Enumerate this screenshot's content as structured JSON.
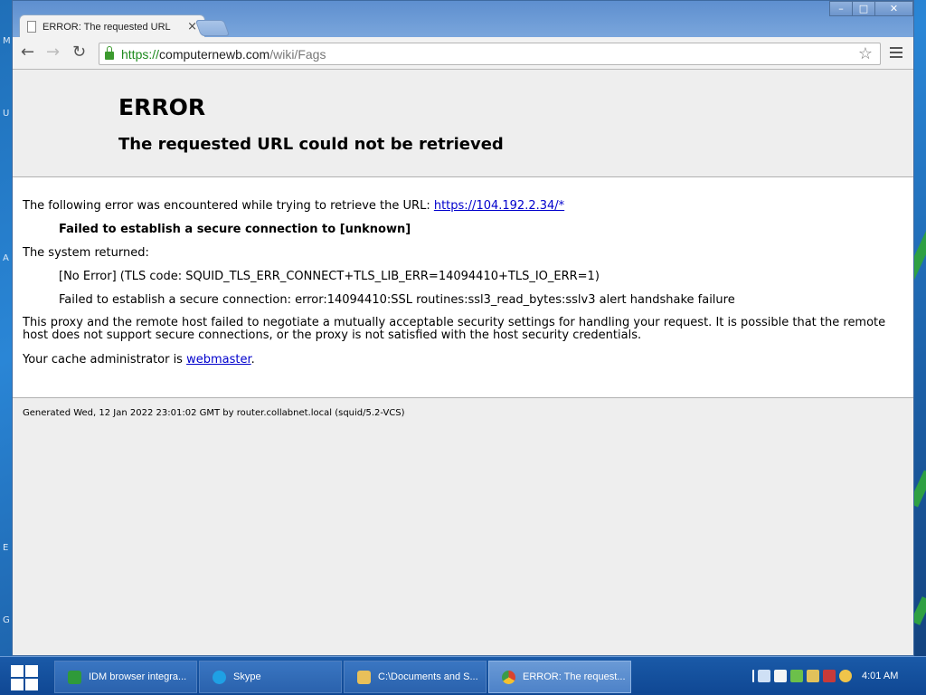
{
  "window": {
    "tab_title": "ERROR: The requested URL",
    "tab_close": "×"
  },
  "toolbar": {
    "url_scheme": "https://",
    "url_host": "computernewb.com",
    "url_path": "/wiki/Fags"
  },
  "page": {
    "title": "ERROR",
    "subtitle": "The requested URL could not be retrieved",
    "intro_text": "The following error was encountered while trying to retrieve the URL: ",
    "intro_link": "https://104.192.2.34/*",
    "failed_msg": "Failed to establish a secure connection to [unknown]",
    "system_returned": "The system returned:",
    "no_error": "[No Error] (TLS code: SQUID_TLS_ERR_CONNECT+TLS_LIB_ERR=14094410+TLS_IO_ERR=1)",
    "ssl_error": "Failed to establish a secure connection: error:14094410:SSL routines:ssl3_read_bytes:sslv3 alert handshake failure",
    "explanation": "This proxy and the remote host failed to negotiate a mutually acceptable security settings for handling your request. It is possible that the remote host does not support secure connections, or the proxy is not satisfied with the host security credentials.",
    "admin_prefix": "Your cache administrator is ",
    "admin_link": "webmaster",
    "admin_suffix": ".",
    "footer": "Generated Wed, 12 Jan 2022 23:01:02 GMT by router.collabnet.local (squid/5.2-VCS)"
  },
  "taskbar": {
    "items": [
      {
        "label": "IDM browser integra...",
        "icon": "idm-icon",
        "color": "#2f9a3a"
      },
      {
        "label": "Skype",
        "icon": "skype-icon",
        "color": "#1fa0e4"
      },
      {
        "label": "C:\\Documents and S...",
        "icon": "folder-icon",
        "color": "#e8c05a"
      },
      {
        "label": "ERROR: The request...",
        "icon": "chrome-icon",
        "color": "#d9432f"
      }
    ],
    "clock": "4:01 AM"
  },
  "desktop": {
    "side_letters": [
      "M",
      "U",
      "A",
      "E",
      "G"
    ]
  }
}
